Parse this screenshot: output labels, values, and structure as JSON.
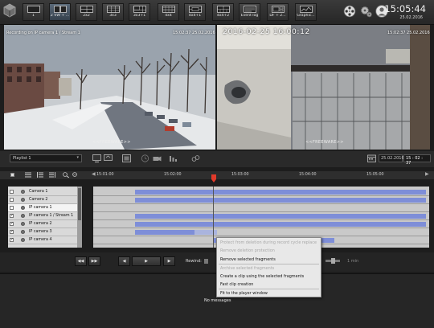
{
  "toolbar": {
    "layouts": [
      {
        "label": "1",
        "icon": "single-view-icon"
      },
      {
        "label": "2 VW + ...",
        "icon": "two-view-icon"
      },
      {
        "label": "2x2",
        "icon": "grid-2x2-icon"
      },
      {
        "label": "3x3",
        "icon": "grid-3x3-icon"
      },
      {
        "label": "3x3+1",
        "icon": "grid-3x3-plus1-icon"
      },
      {
        "label": "4x4",
        "icon": "grid-4x4-icon"
      },
      {
        "label": "4x4+1",
        "icon": "grid-4x4-plus1-icon"
      },
      {
        "label": "4x4+2",
        "icon": "grid-4x4-plus2-icon"
      },
      {
        "label": "Event log",
        "icon": "event-log-icon"
      },
      {
        "label": "DF + 2...",
        "icon": "df-layout-icon"
      },
      {
        "label": "Graphic...",
        "icon": "graphic-layout-icon"
      }
    ],
    "active_layout": 1,
    "time": "15:05:44",
    "date": "25.02.2016"
  },
  "camera_left": {
    "caption": "Recording on IP camera 1 / Stream 1",
    "timestamp": "15:02:37 25.02.2016",
    "watermark": "<<FREEWARE>>"
  },
  "camera_right": {
    "overlay_datetime": "2016-02-25  16:00:12",
    "timestamp": "15:02:37 25.02.2016",
    "watermark": "<<FREEWARE>>"
  },
  "playlist": {
    "selected": "Playlist 1",
    "date": "25.02.2016",
    "time_h": "15",
    "time_m": "02",
    "time_s": "37"
  },
  "timeline": {
    "ticks": [
      "15:01:00",
      "15:02:00",
      "15:03:00",
      "15:04:00",
      "15:05:00"
    ],
    "cameras": [
      {
        "name": "Camera 1",
        "checked": false
      },
      {
        "name": "Camera 2",
        "checked": false
      },
      {
        "name": "IP camera 1",
        "checked": false
      },
      {
        "name": "IP camera 1 / Stream 1",
        "checked": true
      },
      {
        "name": "IP camera 2",
        "checked": true
      },
      {
        "name": "IP camera 3",
        "checked": true
      },
      {
        "name": "IP camera 4",
        "checked": true
      }
    ],
    "check_mark": "✓"
  },
  "controls": {
    "rewind_label": "Rewind:",
    "rewind_value": "1 min"
  },
  "context_menu": {
    "items": [
      {
        "label": "Protect from deletion during record cycle replace",
        "disabled": true
      },
      {
        "label": "Remove deletion protection",
        "disabled": true
      },
      {
        "label": "Remove selected fragments",
        "disabled": false
      },
      {
        "label": "Archive selected fragments",
        "disabled": true
      },
      {
        "label": "Create a clip using the selected fragments",
        "disabled": false
      },
      {
        "label": "Fast clip creation",
        "disabled": false
      },
      {
        "label": "Fit to the player window",
        "disabled": false
      }
    ]
  },
  "messages": {
    "empty_text": "No messages"
  },
  "colors": {
    "track_segment": "#7e8ed8",
    "track_segment_light": "#aab4de",
    "playhead": "#e03a2a"
  }
}
